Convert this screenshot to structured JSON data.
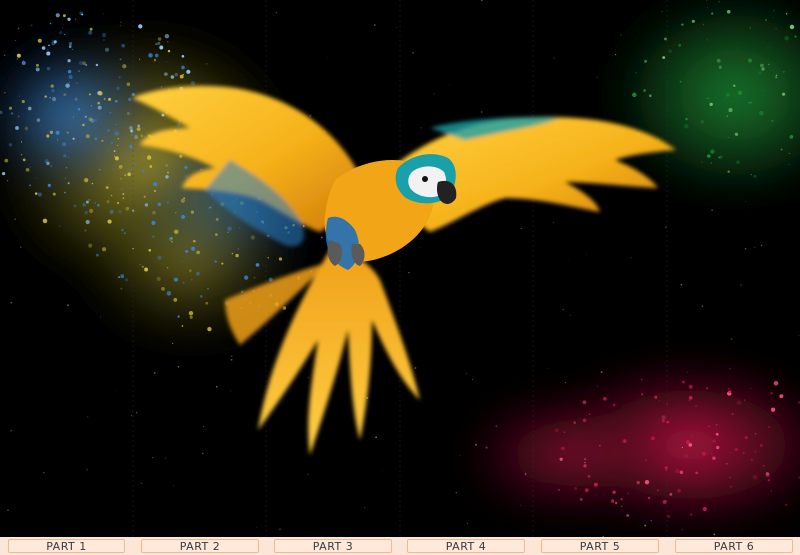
{
  "image": {
    "subject": "macaw-in-flight",
    "palette": {
      "background": "#000000",
      "wing_yellow": "#f6b21a",
      "wing_orange": "#e58a0f",
      "body_blue": "#1f6fb8",
      "teal": "#1aa0a8",
      "cheek_white": "#f2f2f2",
      "dust_yellow": "#d7c33a",
      "dust_blue": "#3b86d8",
      "smoke_green": "#1e8d35",
      "smoke_red": "#d0184c"
    }
  },
  "panels": {
    "labels": [
      "PART 1",
      "PART 2",
      "PART 3",
      "PART 4",
      "PART 5",
      "PART 6"
    ]
  }
}
